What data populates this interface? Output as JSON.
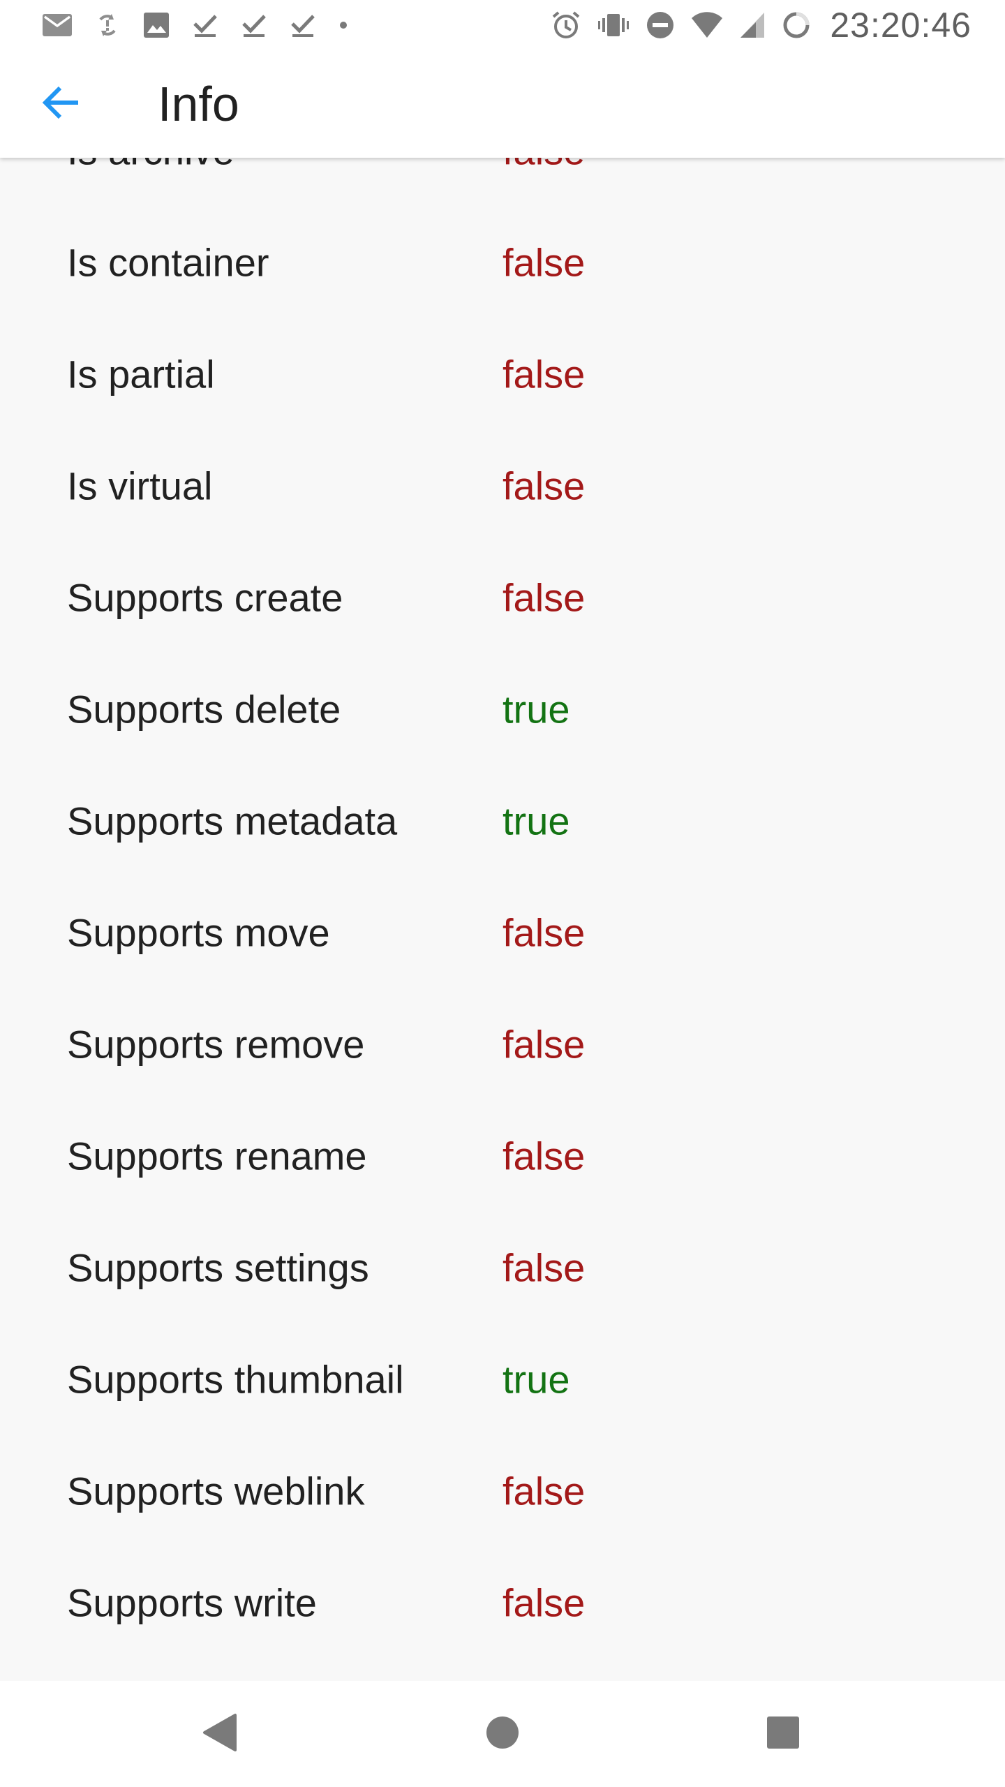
{
  "status_bar": {
    "time": "23:20:46",
    "left_icons": [
      "gmail-icon",
      "sync-problem-icon",
      "image-icon",
      "download-done-icon",
      "download-done-icon",
      "download-done-icon",
      "more-dot-icon"
    ],
    "right_icons": [
      "alarm-icon",
      "vibrate-icon",
      "do-not-disturb-icon",
      "wifi-icon",
      "cell-signal-icon",
      "loading-ring-icon"
    ]
  },
  "app_bar": {
    "title": "Info",
    "back_icon": "arrow-back-icon",
    "accent_color": "#2196f3"
  },
  "colors": {
    "false": "#a31919",
    "true": "#137313"
  },
  "rows": [
    {
      "label": "Is archive",
      "value": "false"
    },
    {
      "label": "Is container",
      "value": "false"
    },
    {
      "label": "Is partial",
      "value": "false"
    },
    {
      "label": "Is virtual",
      "value": "false"
    },
    {
      "label": "Supports create",
      "value": "false"
    },
    {
      "label": "Supports delete",
      "value": "true"
    },
    {
      "label": "Supports metadata",
      "value": "true"
    },
    {
      "label": "Supports move",
      "value": "false"
    },
    {
      "label": "Supports remove",
      "value": "false"
    },
    {
      "label": "Supports rename",
      "value": "false"
    },
    {
      "label": "Supports settings",
      "value": "false"
    },
    {
      "label": "Supports thumbnail",
      "value": "true"
    },
    {
      "label": "Supports weblink",
      "value": "false"
    },
    {
      "label": "Supports write",
      "value": "false"
    }
  ],
  "nav_bar": {
    "buttons": [
      "back-triangle-icon",
      "home-circle-icon",
      "recents-square-icon"
    ]
  }
}
